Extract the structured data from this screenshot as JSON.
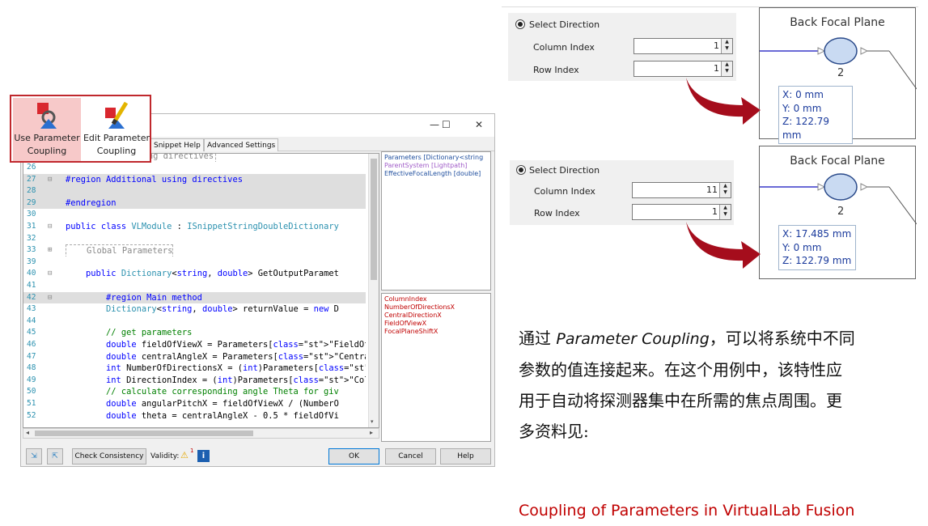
{
  "ribbon": {
    "use_coupling": {
      "line1": "Use Parameter",
      "line2": "Coupling"
    },
    "edit_coupling": {
      "line1": "Edit Parameter",
      "line2": "Coupling"
    }
  },
  "editor": {
    "window_controls": {
      "minimize": "—",
      "maximize": "☐",
      "close": "✕"
    },
    "tabs": [
      "Snippet Help",
      "Advanced Settings"
    ],
    "lines": [
      {
        "n": "26",
        "g": "",
        "text": "",
        "hl": false
      },
      {
        "n": "27",
        "g": "⊟",
        "text": "#region Additional using directives",
        "hl": true
      },
      {
        "n": "28",
        "g": "",
        "text": "",
        "hl": true
      },
      {
        "n": "29",
        "g": "",
        "text": "#endregion",
        "hl": true
      },
      {
        "n": "30",
        "g": "",
        "text": "",
        "hl": false
      },
      {
        "n": "31",
        "g": "⊟",
        "text": "public class VLModule : ISnippetStringDoubleDictionary",
        "hl": false
      },
      {
        "n": "32",
        "g": "",
        "text": "",
        "hl": false
      },
      {
        "n": "33",
        "g": "⊞",
        "text": "    Global Parameters",
        "hl": false
      },
      {
        "n": "39",
        "g": "",
        "text": "",
        "hl": false
      },
      {
        "n": "40",
        "g": "⊟",
        "text": "    public Dictionary<string, double> GetOutputParamet",
        "hl": false
      },
      {
        "n": "41",
        "g": "",
        "text": "",
        "hl": false
      },
      {
        "n": "42",
        "g": "⊟",
        "text": "        #region Main method",
        "hl": true
      },
      {
        "n": "43",
        "g": "",
        "text": "        Dictionary<string, double> returnValue = new D",
        "hl": false
      },
      {
        "n": "44",
        "g": "",
        "text": "",
        "hl": false
      },
      {
        "n": "45",
        "g": "",
        "text": "        // get parameters",
        "hl": false
      },
      {
        "n": "46",
        "g": "",
        "text": "        double fieldOfViewX = Parameters[\"FieldOfViewX",
        "hl": false
      },
      {
        "n": "47",
        "g": "",
        "text": "        double centralAngleX = Parameters[\"CentralDire",
        "hl": false
      },
      {
        "n": "48",
        "g": "",
        "text": "        int NumberOfDirectionsX = (int)Parameters[\"Num",
        "hl": false
      },
      {
        "n": "49",
        "g": "",
        "text": "        int DirectionIndex = (int)Parameters[\"ColumnIn",
        "hl": false
      },
      {
        "n": "50",
        "g": "",
        "text": "        // calculate corresponding angle Theta for giv",
        "hl": false
      },
      {
        "n": "51",
        "g": "",
        "text": "        double angularPitchX = fieldOfViewX / (NumberO",
        "hl": false
      },
      {
        "n": "52",
        "g": "",
        "text": "        double theta = centralAngleX - 0.5 * fieldOfVi",
        "hl": false
      }
    ],
    "partial_top_line": "#region Using directives",
    "params_top": [
      "Parameters [Dictionary<string",
      "ParentSystem [Lightpath]",
      "EffectiveFocalLength [double]"
    ],
    "params_bottom": [
      "ColumnIndex",
      "NumberOfDirectionsX",
      "CentralDirectionX",
      "FieldOfViewX",
      "FocalPlaneShiftX"
    ],
    "footer": {
      "check_consistency": "Check Consistency",
      "validity": "Validity:",
      "validity_count": "1",
      "info": "i",
      "ok": "OK",
      "cancel": "Cancel",
      "help": "Help"
    }
  },
  "panels": [
    {
      "select_direction": "Select Direction",
      "column_label": "Column Index",
      "column_value": "1",
      "row_label": "Row Index",
      "row_value": "1",
      "diagram_title": "Back Focal Plane",
      "node_number": "2",
      "coords": [
        "X: 0 mm",
        "Y: 0 mm",
        "Z: 122.79 mm"
      ]
    },
    {
      "select_direction": "Select Direction",
      "column_label": "Column Index",
      "column_value": "11",
      "row_label": "Row Index",
      "row_value": "1",
      "diagram_title": "Back Focal Plane",
      "node_number": "2",
      "coords": [
        "X: 17.485 mm",
        "Y: 0 mm",
        "Z: 122.79 mm"
      ]
    }
  ],
  "description": {
    "prefix": "通过 ",
    "italic": "Parameter Coupling",
    "line1_rest": "，可以将系统中不同",
    "line2": "参数的值连接起来。在这个用例中，该特性应",
    "line3": "用于自动将探测器集中在所需的焦点周围。更",
    "line4": "多资料见:"
  },
  "link_text": "Coupling of Parameters in VirtualLab Fusion",
  "colors": {
    "highlight_red": "#c0282d",
    "link_red": "#c00000",
    "arrow_red": "#a50d1c",
    "node_fill": "#c9daf2"
  }
}
